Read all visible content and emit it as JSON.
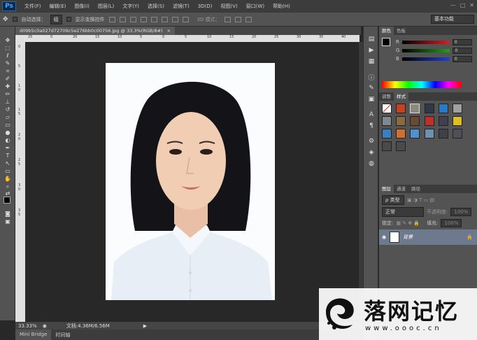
{
  "app": {
    "logo": "Ps"
  },
  "menu": [
    "文件(F)",
    "编辑(E)",
    "图像(I)",
    "图层(L)",
    "文字(Y)",
    "选择(S)",
    "滤镜(T)",
    "3D(D)",
    "视图(V)",
    "窗口(W)",
    "帮助(H)"
  ],
  "window_controls": [
    "—",
    "□",
    "✕"
  ],
  "options": {
    "auto_select_label": "自动选择：",
    "auto_select_value": "组",
    "show_transform_label": "显示变换控件",
    "mode_3d_label": "3D 模式：",
    "workspace": "基本功能"
  },
  "document": {
    "tab_title": "d09b5c0a027d72709c5e276bb0c00756.jpg @ 33.3%(RGB/8#)",
    "tab_close": "×",
    "ruler_top": [
      "25",
      "0",
      "20",
      "15",
      "10",
      "5",
      "0",
      "5",
      "10",
      "15",
      "20",
      "25",
      "30",
      "35",
      "40"
    ],
    "ruler_left": [
      "0",
      "5",
      "1",
      "0",
      "1",
      "5",
      "2",
      "0",
      "2",
      "5",
      "3",
      "0",
      "3",
      "5"
    ]
  },
  "status": {
    "zoom": "33.33%",
    "doc_info": "文档:4.36M/6.56M"
  },
  "bottom_tabs": [
    "Mini Bridge",
    "时间轴"
  ],
  "color_panel": {
    "tabs": [
      "颜色",
      "色板"
    ],
    "channels": [
      {
        "label": "R",
        "value": "0",
        "color": "#d82020"
      },
      {
        "label": "G",
        "value": "0",
        "color": "#20a020"
      },
      {
        "label": "B",
        "value": "0",
        "color": "#2040d0"
      }
    ]
  },
  "styles_panel": {
    "tabs": [
      "调整",
      "样式"
    ]
  },
  "layers_panel": {
    "tabs": [
      "图层",
      "通道",
      "路径"
    ],
    "kind_label": "ρ 类型",
    "blend_mode": "正常",
    "opacity_label": "不透明度:",
    "opacity_value": "100%",
    "lock_label": "锁定:",
    "fill_label": "填充:",
    "fill_value": "100%",
    "layer_name": "背景"
  },
  "watermark": {
    "brand": "落网记忆",
    "url": "www.oooc.cn"
  },
  "colors": {
    "accent": "#4aa3ff",
    "layer_selected": "#6d7a8e",
    "panel_bg": "#535353"
  }
}
